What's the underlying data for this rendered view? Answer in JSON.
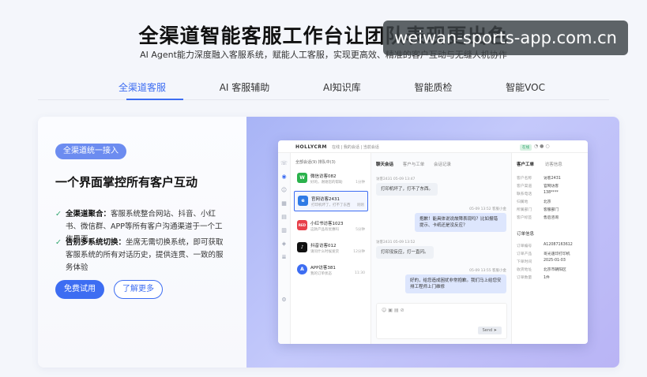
{
  "hero": {
    "title": "全渠道智能客服工作台让团队表现更出色",
    "subtitle": "AI Agent能力深度融入客服系统，赋能人工客服，实现更高效、精准的客户互动与无缝人机协作",
    "watermark": "weiwan-sports-app.com.cn"
  },
  "tabs": [
    {
      "label": "全渠道客服",
      "active": true
    },
    {
      "label": "AI 客服辅助",
      "active": false
    },
    {
      "label": "AI知识库",
      "active": false
    },
    {
      "label": "智能质检",
      "active": false
    },
    {
      "label": "智能VOC",
      "active": false
    }
  ],
  "feature": {
    "badge": "全渠道统一接入",
    "heading": "一个界面掌控所有客户互动",
    "points": [
      {
        "title": "全渠道聚合：",
        "text": "客服系统整合网站、抖音、小红书、微信群、APP等所有客户沟通渠道于一个工作界面。"
      },
      {
        "title": "告别多系统切换：",
        "text": "坐席无需切换系统，即可获取客服系统的所有对话历史，提供连贯、一致的服务体验"
      }
    ],
    "primary_button": "免费试用",
    "secondary_button": "了解更多"
  },
  "app": {
    "logo": "HOLLYCRM",
    "breadcrumb": "在线  |  我的会话  |  当前会话",
    "online_tag": "在线",
    "list_header": "全部会话(9)   排队中(3)",
    "conversations": [
      {
        "name": "微信访客082",
        "preview": "好的，谢谢您的帮助",
        "time": "1分钟",
        "avatar": "W",
        "color": "#2bb24c",
        "active": false
      },
      {
        "name": "官网访客2431",
        "preview": "打印机坏了，打不了东西",
        "time": "刚刚",
        "avatar": "e",
        "color": "#2f7ae5",
        "active": true
      },
      {
        "name": "小红书访客1023",
        "preview": "这款产品有优惠吗",
        "time": "5分钟",
        "avatar": "RED",
        "color": "#e8404a",
        "active": false
      },
      {
        "name": "抖音访客012",
        "preview": "请问什么时候发货",
        "time": "12分钟",
        "avatar": "♪",
        "color": "#111111",
        "active": false
      },
      {
        "name": "APP访客381",
        "preview": "我的订单状态",
        "time": "11:30",
        "avatar": "A",
        "color": "#3d6df2",
        "active": false
      }
    ],
    "chat_tabs": [
      "聊天会话",
      "客户与工单",
      "会话记录"
    ],
    "messages": [
      {
        "side": "in",
        "meta": "访客2431  05-09 13:47",
        "text": "打印机坏了，打不了东西。"
      },
      {
        "side": "out",
        "meta": "05-09 13:52  客服小金",
        "text": "抱歉！能具体说说故障表现吗？比如报错提示、卡纸还是没反应？"
      },
      {
        "side": "in",
        "meta": "访客2431  05-09 13:52",
        "text": "打印没反应，打一直闪。"
      },
      {
        "side": "out",
        "meta": "05-09 13:55  客服小金",
        "text": "好的，给您造成困扰非常抱歉。我们马上给您安排工程师上门维修"
      }
    ],
    "send_label": "Send",
    "panel_tabs": [
      "客户工单",
      "访客信息"
    ],
    "customer_fields": [
      {
        "k": "客户名称",
        "v": "访客2431"
      },
      {
        "k": "客户渠道",
        "v": "官网访客"
      },
      {
        "k": "联系电话",
        "v": "138****"
      },
      {
        "k": "归属地",
        "v": "北京"
      },
      {
        "k": "所属部门",
        "v": "客服部门"
      },
      {
        "k": "客户标签",
        "v": "售后咨询"
      }
    ],
    "order_title": "订单信息",
    "order_fields": [
      {
        "k": "订单编号",
        "v": "A12087163612"
      },
      {
        "k": "订单产品",
        "v": "哥光速印打印机"
      },
      {
        "k": "下单时间",
        "v": "2025-01-03"
      },
      {
        "k": "收货地址",
        "v": "北京市朝阳区"
      },
      {
        "k": "订单数量",
        "v": "1件"
      }
    ]
  }
}
